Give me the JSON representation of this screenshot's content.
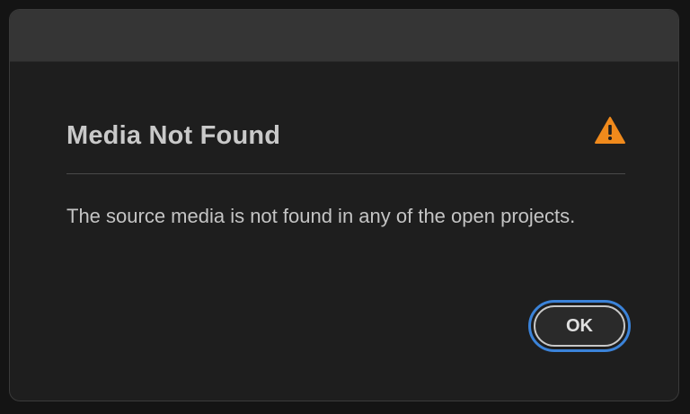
{
  "dialog": {
    "heading": "Media Not Found",
    "message": "The source media is not found in any of the open projects.",
    "ok_label": "OK",
    "icon": "warning-icon"
  },
  "colors": {
    "accent": "#3b83d9",
    "warning": "#f08a1c",
    "background": "#1e1e1e",
    "titlebar": "#353535"
  }
}
